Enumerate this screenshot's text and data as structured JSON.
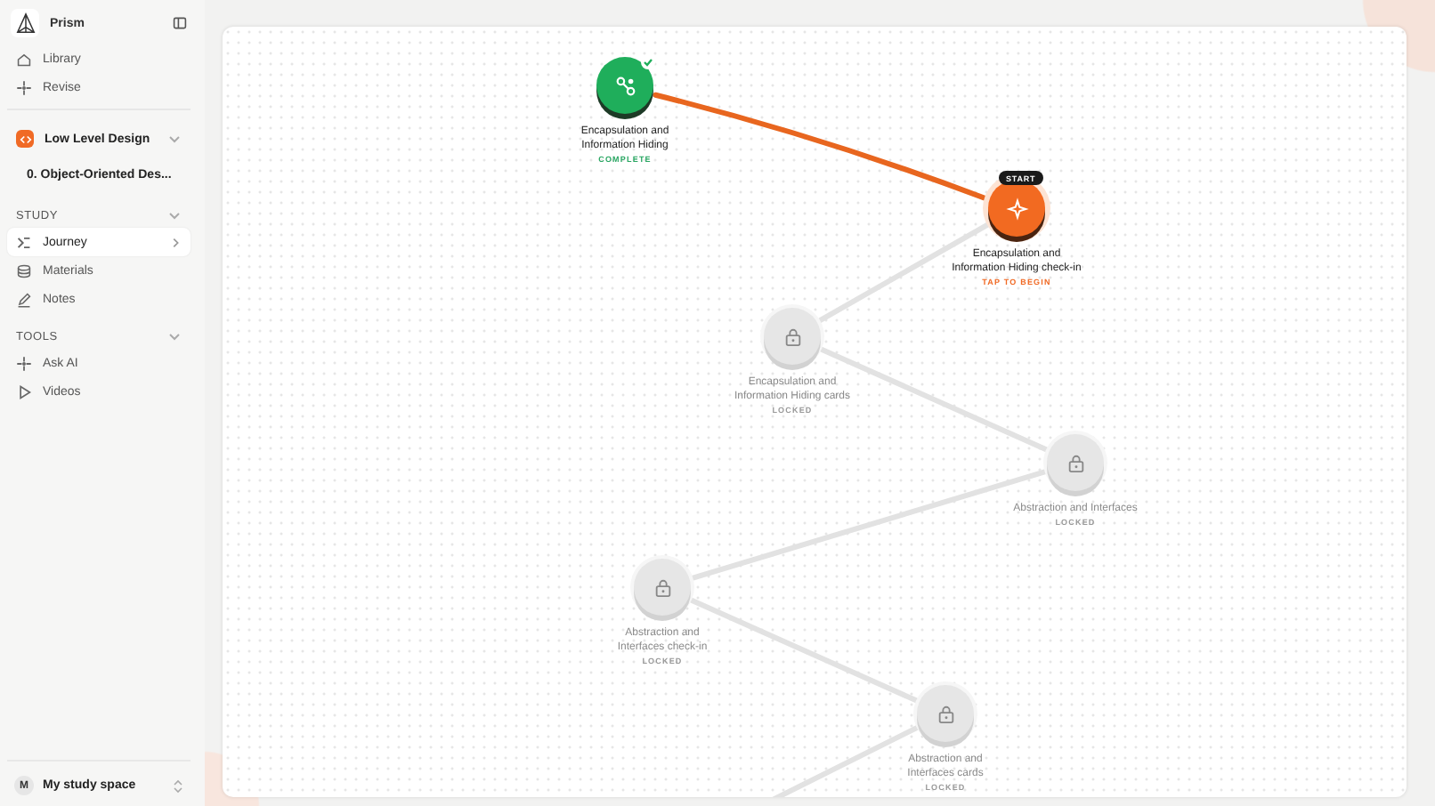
{
  "app": {
    "name": "Prism"
  },
  "nav": [
    {
      "label": "Library"
    },
    {
      "label": "Revise"
    }
  ],
  "course": {
    "title": "Low Level Design"
  },
  "module": {
    "title": "0. Object-Oriented Des..."
  },
  "sections": [
    {
      "title": "STUDY",
      "expanded": true,
      "items": [
        {
          "label": "Journey",
          "selected": true
        },
        {
          "label": "Materials",
          "selected": false
        },
        {
          "label": "Notes",
          "selected": false
        }
      ]
    },
    {
      "title": "TOOLS",
      "expanded": true,
      "items": [
        {
          "label": "Ask AI",
          "selected": false
        },
        {
          "label": "Videos",
          "selected": false
        }
      ]
    }
  ],
  "workspace": {
    "initial": "M",
    "name": "My study space"
  },
  "journey": {
    "nodes": [
      {
        "kind": "complete",
        "title": "Encapsulation and Information Hiding",
        "status": "COMPLETE"
      },
      {
        "kind": "current",
        "title": "Encapsulation and Information Hiding check-in",
        "status": "TAP TO BEGIN",
        "badge": "START"
      },
      {
        "kind": "locked",
        "title": "Encapsulation and Information Hiding cards",
        "status": "LOCKED"
      },
      {
        "kind": "locked",
        "title": "Abstraction and Interfaces",
        "status": "LOCKED"
      },
      {
        "kind": "locked",
        "title": "Abstraction and Interfaces check-in",
        "status": "LOCKED"
      },
      {
        "kind": "locked",
        "title": "Abstraction and Interfaces cards",
        "status": "LOCKED"
      }
    ]
  }
}
